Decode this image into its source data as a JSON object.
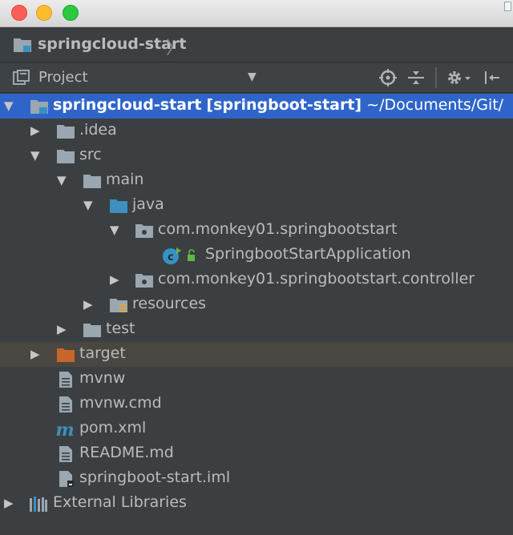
{
  "navbar": {
    "title": "springcloud-start"
  },
  "toolwindow": {
    "view_label": "Project"
  },
  "tree": {
    "root": {
      "name": "springcloud-start",
      "module": "[springboot-start]",
      "path": "~/Documents/Git/"
    },
    "idea": ".idea",
    "src": "src",
    "main": "main",
    "java": "java",
    "pkg1": "com.monkey01.springbootstart",
    "app_class": "SpringbootStartApplication",
    "pkg2": "com.monkey01.springbootstart.controller",
    "resources": "resources",
    "test": "test",
    "target": "target",
    "mvnw": "mvnw",
    "mvnw_cmd": "mvnw.cmd",
    "pom": "pom.xml",
    "readme": "README.md",
    "iml": "springboot-start.iml",
    "ext_libs": "External Libraries"
  },
  "icons": [
    "folder-icon",
    "module-folder-icon",
    "package-icon",
    "class-icon",
    "maven-icon",
    "file-icon",
    "libraries-icon",
    "gear-icon",
    "locate-icon",
    "collapse-icon",
    "hide-icon"
  ],
  "colors": {
    "selection": "#2f65ca",
    "background": "#3c3f41",
    "excluded_folder": "#c8652a",
    "source_folder": "#3d8fbf",
    "text": "#bbbbbb"
  }
}
